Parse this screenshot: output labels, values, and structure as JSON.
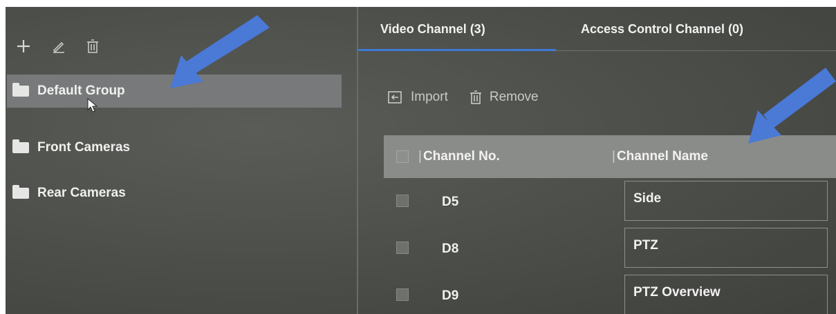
{
  "toolbar": {
    "icons": [
      "plus-icon",
      "pencil-icon",
      "trash-icon"
    ]
  },
  "groups": [
    {
      "label": "Default Group",
      "selected": true
    },
    {
      "label": "Front Cameras",
      "selected": false
    },
    {
      "label": "Rear Cameras",
      "selected": false
    }
  ],
  "tabs": [
    {
      "label": "Video Channel (3)",
      "active": true
    },
    {
      "label": "Access Control Channel (0)",
      "active": false
    }
  ],
  "actions": {
    "import_label": "Import",
    "remove_label": "Remove"
  },
  "table": {
    "columns": [
      "Channel No.",
      "Channel Name"
    ],
    "rows": [
      {
        "channel_no": "D5",
        "channel_name": "Side"
      },
      {
        "channel_no": "D8",
        "channel_name": "PTZ"
      },
      {
        "channel_no": "D9",
        "channel_name": "PTZ Overview"
      }
    ]
  },
  "colors": {
    "tab_accent": "#3d7ad8",
    "annotation_arrow": "#4a79d6"
  }
}
